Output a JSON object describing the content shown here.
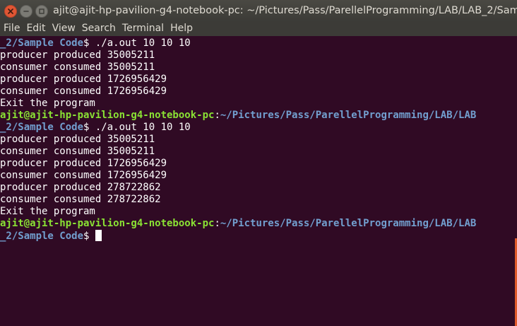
{
  "window": {
    "title": "ajit@ajit-hp-pavilion-g4-notebook-pc: ~/Pictures/Pass/ParellelProgramming/LAB/LAB_2/Sample Code",
    "controls": {
      "close_icon": "close-icon",
      "minimize_icon": "minimize-icon",
      "maximize_icon": "maximize-icon"
    }
  },
  "menubar": {
    "items": [
      "File",
      "Edit",
      "View",
      "Search",
      "Terminal",
      "Help"
    ]
  },
  "colors": {
    "background": "#300a24",
    "user": "#8ae234",
    "path": "#729fcf",
    "text": "#ffffff",
    "accent": "#e05634"
  },
  "terminal": {
    "lines": [
      {
        "type": "prompt_cont",
        "path": "_2/Sample Code",
        "suffix": "$ ./a.out 10 10 10"
      },
      {
        "type": "output",
        "text": "producer produced 35005211"
      },
      {
        "type": "output",
        "text": "consumer consumed 35005211"
      },
      {
        "type": "output",
        "text": "producer produced 1726956429"
      },
      {
        "type": "output",
        "text": "consumer consumed 1726956429"
      },
      {
        "type": "output",
        "text": "Exit the program"
      },
      {
        "type": "prompt_start",
        "user": "ajit@ajit-hp-pavilion-g4-notebook-pc",
        "sep": ":",
        "path": "~/Pictures/Pass/ParellelProgramming/LAB/LAB"
      },
      {
        "type": "prompt_cont",
        "path": "_2/Sample Code",
        "suffix": "$ ./a.out 10 10 10"
      },
      {
        "type": "output",
        "text": "producer produced 35005211"
      },
      {
        "type": "output",
        "text": "consumer consumed 35005211"
      },
      {
        "type": "output",
        "text": "producer produced 1726956429"
      },
      {
        "type": "output",
        "text": "consumer consumed 1726956429"
      },
      {
        "type": "output",
        "text": "producer produced 278722862"
      },
      {
        "type": "output",
        "text": "consumer consumed 278722862"
      },
      {
        "type": "output",
        "text": "Exit the program"
      },
      {
        "type": "prompt_start",
        "user": "ajit@ajit-hp-pavilion-g4-notebook-pc",
        "sep": ":",
        "path": "~/Pictures/Pass/ParellelProgramming/LAB/LAB"
      },
      {
        "type": "prompt_cont",
        "path": "_2/Sample Code",
        "suffix": "$ ",
        "cursor": true
      }
    ]
  }
}
